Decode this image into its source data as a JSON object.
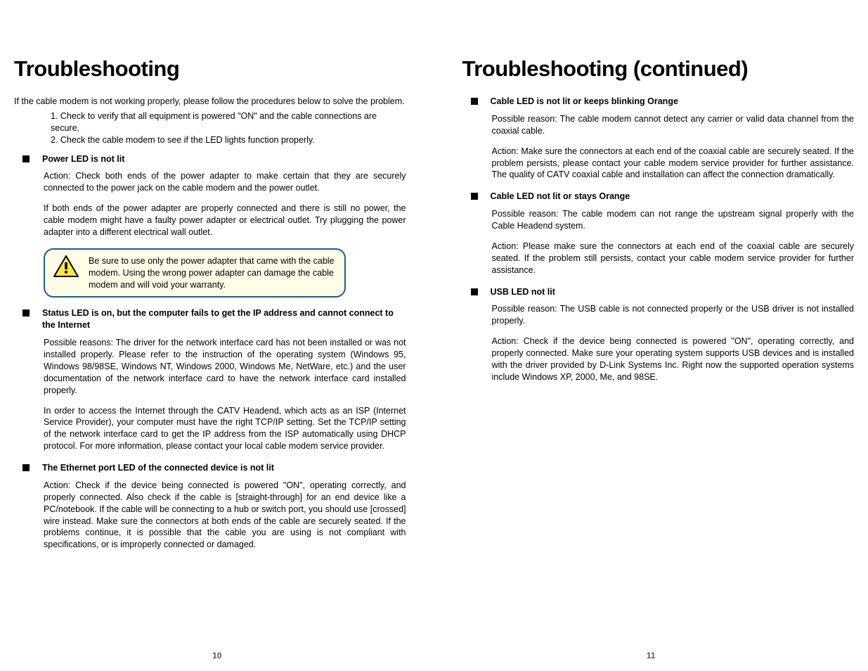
{
  "left": {
    "heading": "Troubleshooting",
    "intro": "If the cable modem is not working properly, please follow the procedures below to solve the problem.",
    "steps": {
      "s1": "1. Check to verify that all equipment is powered \"ON\" and the cable connections are secure.",
      "s2": "2. Check the cable modem to see if the LED lights function properly."
    },
    "sec1": {
      "title": "Power LED is not lit",
      "p1": "Action: Check both ends of the power adapter to make certain that they are securely connected to the power jack on the cable modem and the power outlet.",
      "p2": "If both ends of the power adapter are properly connected and there is still no power, the cable modem might have a faulty power adapter or electrical outlet. Try plugging the power adapter into a different electrical wall outlet."
    },
    "warning": "Be sure to use only the power adapter that came with the cable modem. Using the wrong power adapter can damage the cable modem and will void your warranty.",
    "sec2": {
      "title": "Status LED is on, but the computer fails to get the  IP address and cannot connect  to  the Internet",
      "p1": "Possible reasons: The driver for the network interface card has not been installed or was not installed properly. Please refer to the instruction of the operating system (Windows 95, Windows 98/98SE, Windows NT, Windows 2000, Windows Me, NetWare, etc.) and the user documentation of the network interface card to have the network interface card installed properly.",
      "p2": "In order to access the Internet through the CATV Headend, which acts as an ISP (Internet Service Provider), your computer must have the right TCP/IP setting. Set the TCP/IP setting of the network interface card to get the IP address from the ISP automatically using DHCP protocol. For more information, please contact your local cable modem service provider."
    },
    "sec3": {
      "title": "The Ethernet port LED of the connected device is not lit",
      "p1": "Action: Check if the device being connected is powered \"ON\", operating correctly, and properly connected. Also check if the cable is [straight-through] for an end device like a PC/notebook. If the cable will be connecting to a hub or switch port, you should use [crossed] wire instead. Make sure the connectors at both ends of the cable are securely seated. If the problems continue, it is possible that the cable you are using is not compliant with specifications, or is improperly connected or damaged."
    },
    "pageNum": "10"
  },
  "right": {
    "heading": "Troubleshooting (continued)",
    "sec1": {
      "title": "Cable LED is not lit or keeps blinking Orange",
      "p1": "Possible reason: The cable modem cannot detect any carrier or valid data channel from the coaxial cable.",
      "p2": "Action: Make sure the connectors at each end of the coaxial cable are securely seated. If the problem persists, please contact your cable modem service provider for further assistance. The quality of CATV coaxial cable and installation can affect the connection dramatically."
    },
    "sec2": {
      "title": "Cable LED not lit or stays Orange",
      "p1": "Possible reason: The cable modem can not range the upstream signal properly with the Cable Headend system.",
      "p2": "Action: Please make sure the connectors at each end of the coaxial cable are securely seated. If the problem still persists, contact your cable modem service provider for further assistance."
    },
    "sec3": {
      "title": "USB LED  not lit",
      "p1": "Possible reason: The USB cable is not connected properly or the USB driver is not installed properly.",
      "p2": "Action: Check if the device being connected is powered \"ON\", operating correctly, and properly connected. Make sure your operating system supports USB devices and is installed with the driver provided by D-Link Systems Inc. Right now the supported operation systems include Windows XP, 2000, Me, and 98SE."
    },
    "pageNum": "11"
  }
}
